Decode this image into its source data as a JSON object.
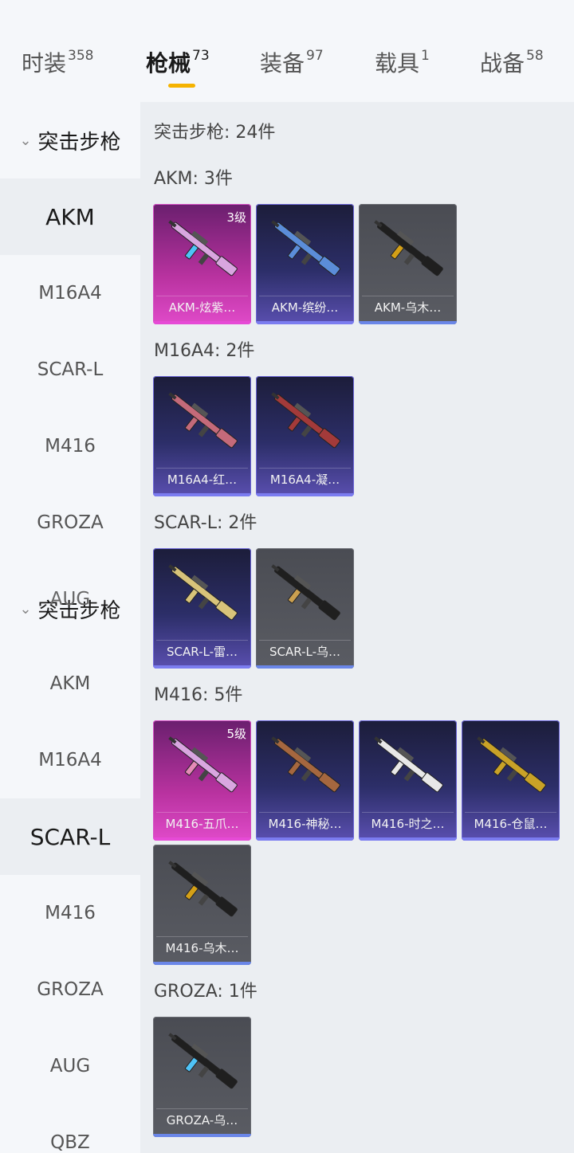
{
  "tabs": [
    {
      "label": "时装",
      "count": "358"
    },
    {
      "label": "枪械",
      "count": "73"
    },
    {
      "label": "装备",
      "count": "97"
    },
    {
      "label": "载具",
      "count": "1"
    },
    {
      "label": "战备",
      "count": "58"
    }
  ],
  "sidebar": {
    "category": "突击步枪",
    "category_repeat": "突击步枪",
    "items": [
      "AKM",
      "M16A4",
      "SCAR-L",
      "M416",
      "GROZA",
      "AUG"
    ],
    "items_second": [
      "AKM",
      "M16A4",
      "SCAR-L",
      "M416",
      "GROZA",
      "AUG",
      "QBZ"
    ]
  },
  "content": {
    "total": "突击步枪: 24件",
    "groups": [
      {
        "title": "AKM: 3件",
        "cards": [
          {
            "name": "AKM-炫紫…",
            "level": "3级",
            "rarity": "purple",
            "icon": "rifle-icon"
          },
          {
            "name": "AKM-缤纷…",
            "rarity": "blue",
            "icon": "rifle-icon"
          },
          {
            "name": "AKM-乌木…",
            "rarity": "grey",
            "icon": "rifle-icon"
          }
        ]
      },
      {
        "title": "M16A4: 2件",
        "cards": [
          {
            "name": "M16A4-红…",
            "rarity": "blue",
            "icon": "rifle-icon"
          },
          {
            "name": "M16A4-凝…",
            "rarity": "blue",
            "icon": "rifle-icon"
          }
        ]
      },
      {
        "title": "SCAR-L: 2件",
        "cards": [
          {
            "name": "SCAR-L-雷…",
            "rarity": "blue",
            "icon": "rifle-icon"
          },
          {
            "name": "SCAR-L-乌…",
            "rarity": "grey",
            "icon": "rifle-icon"
          }
        ]
      },
      {
        "title": "M416: 5件",
        "cards": [
          {
            "name": "M416-五爪…",
            "level": "5级",
            "rarity": "purple",
            "icon": "rifle-icon"
          },
          {
            "name": "M416-神秘…",
            "rarity": "blue",
            "icon": "rifle-icon"
          },
          {
            "name": "M416-时之…",
            "rarity": "blue",
            "icon": "rifle-icon"
          },
          {
            "name": "M416-仓鼠…",
            "rarity": "blue",
            "icon": "rifle-icon"
          },
          {
            "name": "M416-乌木…",
            "rarity": "grey",
            "icon": "rifle-icon"
          }
        ]
      },
      {
        "title": "GROZA: 1件",
        "cards": [
          {
            "name": "GROZA-乌…",
            "rarity": "grey",
            "icon": "rifle-icon"
          }
        ]
      }
    ]
  },
  "colors": {
    "accent": "#f5b300",
    "rarity_purple": "#e64ad6",
    "rarity_blue": "#7b7cf0",
    "rarity_grey": "#6a86e8"
  }
}
